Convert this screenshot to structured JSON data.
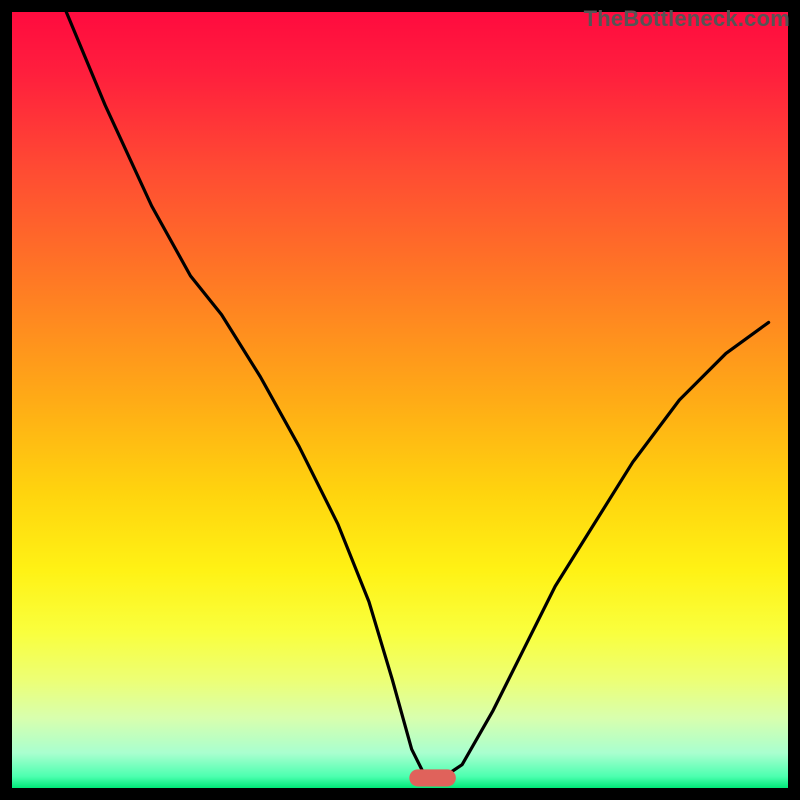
{
  "watermark": "TheBottleneck.com",
  "chart_data": {
    "type": "line",
    "title": "",
    "xlabel": "",
    "ylabel": "",
    "xlim": [
      0,
      100
    ],
    "ylim": [
      0,
      100
    ],
    "grid": false,
    "legend": false,
    "background": {
      "type": "vertical-gradient",
      "stops": [
        {
          "pos": 0.0,
          "color": "#ff0b3f"
        },
        {
          "pos": 0.08,
          "color": "#ff1f3d"
        },
        {
          "pos": 0.2,
          "color": "#ff4a33"
        },
        {
          "pos": 0.35,
          "color": "#ff7a24"
        },
        {
          "pos": 0.5,
          "color": "#ffab16"
        },
        {
          "pos": 0.62,
          "color": "#ffd40e"
        },
        {
          "pos": 0.72,
          "color": "#fff215"
        },
        {
          "pos": 0.8,
          "color": "#f9ff3e"
        },
        {
          "pos": 0.86,
          "color": "#edff74"
        },
        {
          "pos": 0.91,
          "color": "#d8ffae"
        },
        {
          "pos": 0.955,
          "color": "#a9ffcf"
        },
        {
          "pos": 0.985,
          "color": "#4dffb0"
        },
        {
          "pos": 1.0,
          "color": "#00e878"
        }
      ]
    },
    "series": [
      {
        "name": "bottleneck-curve",
        "color": "#000000",
        "x": [
          7.0,
          12.0,
          18.0,
          23.0,
          27.0,
          32.0,
          37.0,
          42.0,
          46.0,
          49.0,
          51.5,
          53.5,
          55.0,
          58.0,
          62.0,
          66.0,
          70.0,
          75.0,
          80.0,
          86.0,
          92.0,
          97.5
        ],
        "y": [
          100.0,
          88.0,
          75.0,
          66.0,
          61.0,
          53.0,
          44.0,
          34.0,
          24.0,
          14.0,
          5.0,
          1.0,
          1.0,
          3.0,
          10.0,
          18.0,
          26.0,
          34.0,
          42.0,
          50.0,
          56.0,
          60.0
        ]
      }
    ],
    "marker": {
      "name": "optimal-pill",
      "color": "#e0625b",
      "x_center": 54.2,
      "y_center": 1.3,
      "width": 6.0,
      "height": 2.2,
      "rx": 1.1
    },
    "frame": {
      "color": "#000000",
      "stroke_width": 12
    }
  }
}
